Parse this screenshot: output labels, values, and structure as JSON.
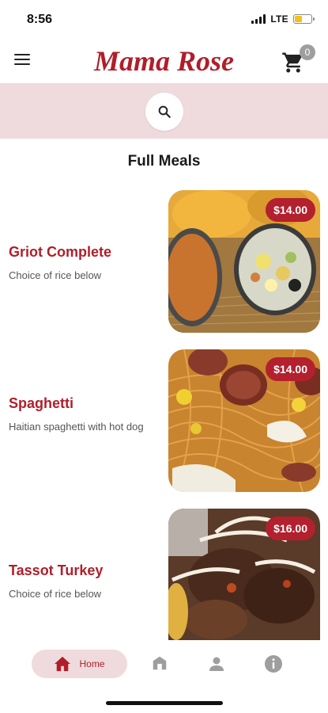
{
  "status_bar": {
    "time": "8:56",
    "network": "LTE"
  },
  "header": {
    "title": "Mama Rose",
    "cart_count": "0"
  },
  "icons": {
    "menu": "hamburger-menu-icon",
    "cart": "shopping-cart-icon",
    "search": "search-icon",
    "home": "home-icon",
    "store": "store-icon",
    "profile": "person-icon",
    "info": "info-icon"
  },
  "colors": {
    "brand": "#b01e2a",
    "band": "#efdadd",
    "badge": "#9e9e9e"
  },
  "section_title": "Full Meals",
  "meals": [
    {
      "name": "Griot Complete",
      "description": "Choice of rice below",
      "price": "$14.00"
    },
    {
      "name": "Spaghetti",
      "description": "Haitian spaghetti with hot dog",
      "price": "$14.00"
    },
    {
      "name": "Tassot Turkey",
      "description": "Choice of rice below",
      "price": "$16.00"
    }
  ],
  "nav": {
    "home_label": "Home"
  }
}
